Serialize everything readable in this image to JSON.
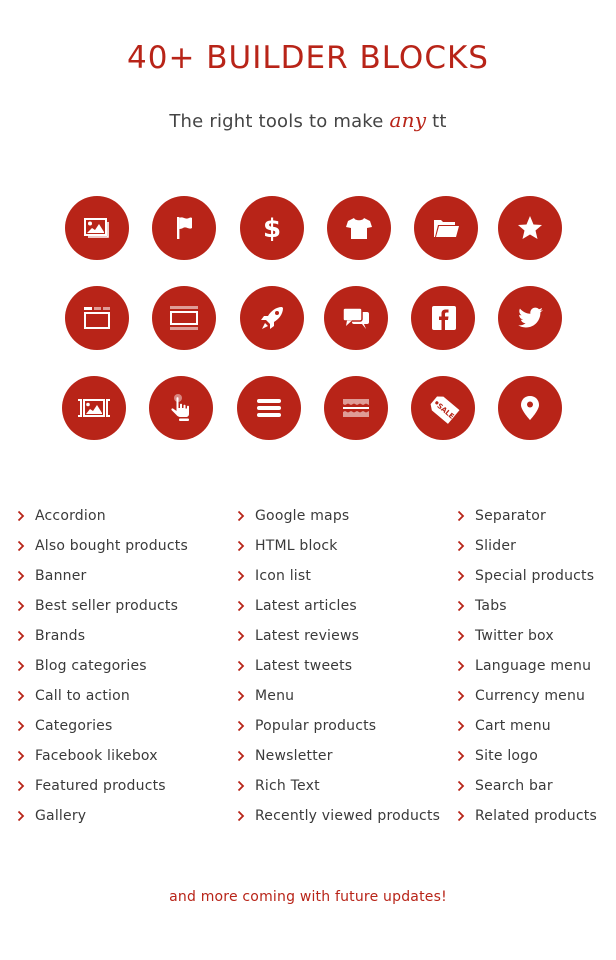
{
  "header": {
    "title": "40+ BUILDER BLOCKS",
    "subtitle_pre": "The right tools to make ",
    "subtitle_accent": "any",
    "subtitle_post": " tt"
  },
  "colors": {
    "accent": "#b82418",
    "text": "#3a3a3a",
    "background": "#ffffff"
  },
  "icons": [
    [
      "gallery-images-icon",
      "flag-icon",
      "dollar-icon",
      "tshirt-icon",
      "folder-open-icon",
      "star-icon"
    ],
    [
      "browser-tabs-icon",
      "banner-layout-icon",
      "rocket-icon",
      "chat-bubbles-icon",
      "facebook-icon",
      "twitter-icon"
    ],
    [
      "image-slider-icon",
      "tap-hand-icon",
      "hamburger-menu-icon",
      "separator-icon",
      "sale-tag-icon",
      "map-pin-icon"
    ]
  ],
  "sale_tag_text": "SALE",
  "lists": [
    [
      "Accordion",
      "Also bought products",
      "Banner",
      "Best seller products",
      "Brands",
      "Blog categories",
      "Call to action",
      "Categories",
      "Facebook likebox",
      "Featured products",
      "Gallery"
    ],
    [
      "Google maps",
      "HTML block",
      "Icon list",
      "Latest articles",
      "Latest reviews",
      "Latest tweets",
      "Menu",
      "Popular products",
      "Newsletter",
      "Rich Text",
      "Recently viewed products"
    ],
    [
      "Separator",
      "Slider",
      "Special products",
      "Tabs",
      "Twitter box",
      "Language menu",
      "Currency menu",
      "Cart menu",
      "Site logo",
      "Search bar",
      "Related products"
    ]
  ],
  "footer": {
    "text": "and more coming with future updates!"
  }
}
